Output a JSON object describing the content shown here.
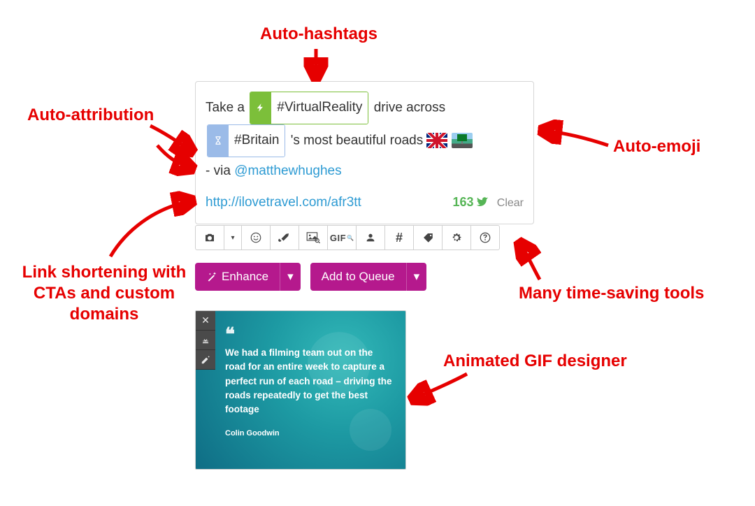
{
  "annotations": {
    "auto_hashtags": "Auto-hashtags",
    "auto_attribution": "Auto-attribution",
    "auto_emoji": "Auto-emoji",
    "link_shortening": "Link shortening with CTAs and custom domains",
    "many_tools": "Many time-saving tools",
    "gif_designer": "Animated GIF designer"
  },
  "compose": {
    "text_before_tag1": "Take a ",
    "tag1": "#VirtualReality",
    "text_after_tag1": " drive across",
    "tag2": "#Britain",
    "text_after_tag2": "'s most beautiful roads ",
    "via_prefix": "- via ",
    "mention": "@matthewhughes",
    "url": "http://ilovetravel.com/afr3tt",
    "char_count": "163",
    "clear": "Clear"
  },
  "toolbar": {
    "items": [
      {
        "name": "camera-icon",
        "glyph": "📷"
      },
      {
        "name": "camera-dropdown-icon",
        "glyph": "▾"
      },
      {
        "name": "emoji-icon",
        "glyph": "☺"
      },
      {
        "name": "brush-icon",
        "glyph": "✎"
      },
      {
        "name": "image-search-icon",
        "glyph": "🖼"
      },
      {
        "name": "gif-icon",
        "glyph": "GIF"
      },
      {
        "name": "person-icon",
        "glyph": "👤"
      },
      {
        "name": "hashtag-icon",
        "glyph": "#"
      },
      {
        "name": "tag-icon",
        "glyph": "🏷"
      },
      {
        "name": "gear-icon",
        "glyph": "⚙"
      },
      {
        "name": "help-icon",
        "glyph": "?"
      }
    ]
  },
  "actions": {
    "enhance": "Enhance",
    "add_to_queue": "Add to Queue"
  },
  "gif": {
    "quote": "We had a filming team out on the road for an entire week to capture a perfect run of each road – driving the roads repeatedly to get the best footage",
    "author": "Colin Goodwin"
  }
}
